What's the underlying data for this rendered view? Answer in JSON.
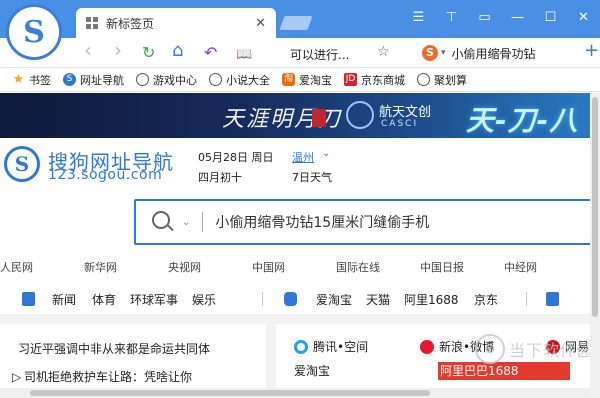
{
  "titlebar": {
    "logo_letter": "S",
    "tab_title": "新标签页",
    "tab_close": "✕",
    "controls": [
      "☰",
      "⊤",
      "▭",
      "—",
      "☐",
      "✕"
    ]
  },
  "navbar": {
    "back": "‹",
    "forward": "›",
    "refresh": "↻",
    "home": "⌂",
    "undo": "↶",
    "reader": "📖",
    "address": "可以进行...",
    "star": "☆",
    "search_engine_letter": "S",
    "search_caret": "▾",
    "search_query": "小偷用缩骨功钻",
    "add_tab": "+"
  },
  "bookmarks": [
    {
      "label": "书签",
      "icon": "star"
    },
    {
      "label": "网址导航",
      "icon": "sogou"
    },
    {
      "label": "游戏中心",
      "icon": "globe"
    },
    {
      "label": "小说大全",
      "icon": "globe"
    },
    {
      "label": "爱淘宝",
      "icon": "taobao"
    },
    {
      "label": "京东商城",
      "icon": "jd"
    },
    {
      "label": "聚划算",
      "icon": "globe"
    }
  ],
  "banner": {
    "brand1": "天涯明月刀",
    "brand2": "航天文创",
    "brand2_sub": "CASCI",
    "brand3": "天-刀-八"
  },
  "header": {
    "logo_letter": "S",
    "title": "搜狗网址导航",
    "url": "123.sogou.com",
    "date": "05月28日 周日",
    "lunar": "四月初十",
    "city": "温州",
    "city_caret": "⌄",
    "weather": "7日天气"
  },
  "search": {
    "query": "小偷用缩骨功钻15厘米门缝偷手机",
    "dropdown": "⌄"
  },
  "sites": [
    "人民网",
    "新华网",
    "央视网",
    "中国网",
    "国际在线",
    "中国日报",
    "中经网"
  ],
  "categories": {
    "group1": [
      "新闻",
      "体育",
      "环球军事",
      "娱乐"
    ],
    "group2": [
      "爱淘宝",
      "天猫",
      "阿里1688",
      "京东"
    ]
  },
  "news": [
    "习近平强调中非从来都是命运共同体",
    "司机拒绝救护车让路：凭啥让你"
  ],
  "right_panel": {
    "r1c1": "腾讯•空间",
    "r1c2": "新浪•微博",
    "r1c3": "网易",
    "r2c1": "爱淘宝",
    "r2c2": "阿里巴巴1688"
  },
  "watermark": {
    "text": "当下软件园"
  }
}
